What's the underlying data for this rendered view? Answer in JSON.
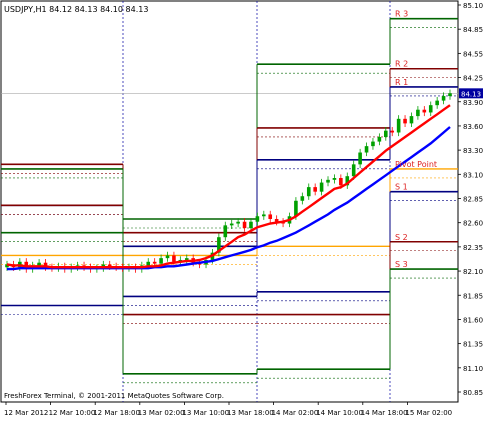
{
  "header": {
    "symbol_label": "USDJPY,H1  84.12 84.13 84.10 84.13"
  },
  "footer": {
    "copyright": "FreshForex Terminal, © 2001-2011 MetaQuotes Software Corp."
  },
  "price_axis": {
    "ticks": [
      "85.10",
      "84.85",
      "84.55",
      "84.25",
      "83.90",
      "83.60",
      "83.30",
      "83.10",
      "82.85",
      "82.60",
      "82.35",
      "82.10",
      "81.85",
      "81.60",
      "81.35",
      "81.10",
      "80.85"
    ],
    "current_price": "84.13"
  },
  "time_axis": {
    "labels": [
      "12 Mar 2012",
      "12 Mar 10:00",
      "12 Mar 18:00",
      "13 Mar 02:00",
      "13 Mar 10:00",
      "13 Mar 18:00",
      "14 Mar 02:00",
      "14 Mar 10:00",
      "14 Mar 18:00",
      "15 Mar 02:00"
    ]
  },
  "pivot_labels": {
    "r3": "R 3",
    "r2": "R 2",
    "r1": "R 1",
    "pp": "Pivot Point",
    "s1": "S 1",
    "s2": "S 2",
    "s3": "S 3"
  },
  "colors": {
    "background": "#ffffff",
    "axis": "#000000",
    "bull_candle": "#00a000",
    "bear_candle": "#ff0000",
    "ma_fast": "#ff0000",
    "ma_slow": "#0000ff",
    "r3_s3": "#006400",
    "r2_s2": "#800000",
    "r1_s1": "#000080",
    "pivot": "#ffa500",
    "price_badge": "#0000a0"
  },
  "chart_data": {
    "type": "candlestick",
    "symbol": "USDJPY",
    "timeframe": "H1",
    "ohlc_header": {
      "open": 84.12,
      "high": 84.13,
      "low": 84.1,
      "close": 84.13
    },
    "ylim": [
      80.85,
      85.1
    ],
    "close_series": [
      82.25,
      82.22,
      82.28,
      82.2,
      82.24,
      82.27,
      82.22,
      82.21,
      82.23,
      82.2,
      82.22,
      82.24,
      82.22,
      82.2,
      82.21,
      82.25,
      82.23,
      82.22,
      82.21,
      82.22,
      82.2,
      82.24,
      82.28,
      82.26,
      82.32,
      82.35,
      82.28,
      82.3,
      82.32,
      82.27,
      82.25,
      82.3,
      82.38,
      82.55,
      82.68,
      82.7,
      82.72,
      82.65,
      82.72,
      82.78,
      82.8,
      82.75,
      82.72,
      82.7,
      82.78,
      82.95,
      83.0,
      83.1,
      83.05,
      83.15,
      83.18,
      83.2,
      83.12,
      83.22,
      83.35,
      83.48,
      83.55,
      83.6,
      83.65,
      83.72,
      83.7,
      83.85,
      83.8,
      83.88,
      83.95,
      83.92,
      84.0,
      84.05,
      84.1,
      84.13
    ],
    "ma_fast": [
      82.25,
      82.24,
      82.24,
      82.23,
      82.23,
      82.23,
      82.23,
      82.22,
      82.22,
      82.22,
      82.22,
      82.22,
      82.22,
      82.22,
      82.22,
      82.22,
      82.22,
      82.22,
      82.22,
      82.22,
      82.22,
      82.22,
      82.23,
      82.23,
      82.24,
      82.26,
      82.27,
      82.28,
      82.29,
      82.29,
      82.3,
      82.32,
      82.35,
      82.4,
      82.45,
      82.5,
      82.55,
      82.58,
      82.62,
      82.66,
      82.68,
      82.7,
      82.71,
      82.72,
      82.74,
      82.78,
      82.83,
      82.88,
      82.93,
      82.98,
      83.03,
      83.08,
      83.1,
      83.14,
      83.2,
      83.26,
      83.32,
      83.38,
      83.44,
      83.5,
      83.55,
      83.6,
      83.65,
      83.7,
      83.75,
      83.8,
      83.85,
      83.9,
      83.95,
      84.0
    ],
    "ma_slow": [
      82.2,
      82.2,
      82.21,
      82.21,
      82.21,
      82.21,
      82.21,
      82.21,
      82.21,
      82.21,
      82.21,
      82.21,
      82.21,
      82.21,
      82.21,
      82.21,
      82.21,
      82.21,
      82.21,
      82.21,
      82.21,
      82.21,
      82.21,
      82.22,
      82.22,
      82.23,
      82.23,
      82.24,
      82.25,
      82.26,
      82.27,
      82.28,
      82.29,
      82.31,
      82.33,
      82.35,
      82.37,
      82.39,
      82.41,
      82.44,
      82.46,
      82.49,
      82.51,
      82.54,
      82.57,
      82.6,
      82.64,
      82.68,
      82.72,
      82.76,
      82.8,
      82.85,
      82.89,
      82.93,
      82.98,
      83.03,
      83.08,
      83.13,
      83.18,
      83.23,
      83.28,
      83.33,
      83.38,
      83.43,
      83.48,
      83.53,
      83.58,
      83.64,
      83.7,
      83.76
    ],
    "pivot_days": [
      {
        "R3": 82.6,
        "R2": 83.35,
        "R1": 82.9,
        "PP": 82.35,
        "S1": 81.8,
        "S2": 82.9,
        "S3": 83.3
      },
      {
        "R3": 82.75,
        "R2": 82.6,
        "R1": 82.45,
        "PP": 82.35,
        "S1": 81.9,
        "S2": 81.7,
        "S3": 81.05
      },
      {
        "R3": 84.45,
        "R2": 83.75,
        "R1": 83.4,
        "PP": 82.45,
        "S1": 81.95,
        "S2": 81.7,
        "S3": 81.1
      },
      {
        "R3": 84.95,
        "R2": 84.4,
        "R1": 84.2,
        "PP": 83.3,
        "S1": 83.05,
        "S2": 82.5,
        "S3": 82.2
      }
    ]
  }
}
